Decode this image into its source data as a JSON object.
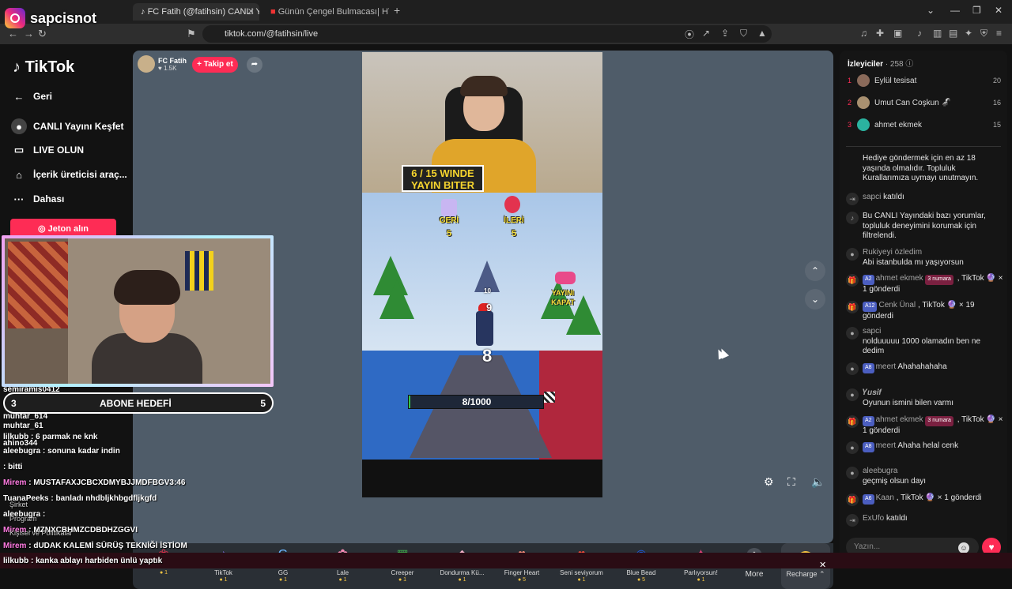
{
  "overlay": {
    "brand": "sapcisnot"
  },
  "browser": {
    "tabs": [
      {
        "label": "FC Fatih (@fatihsin) CANLI Ya",
        "active": true
      },
      {
        "label": "Günün Çengel Bulmacası| HT Bulmac",
        "active": false
      }
    ],
    "url": "tiktok.com/@fatihsin/live"
  },
  "sidebar": {
    "logo": "TikTok",
    "items": [
      {
        "label": "Geri",
        "icon": "arrow-left-icon"
      },
      {
        "label": "CANLI Yayını Keşfet",
        "icon": "live-explore-icon"
      },
      {
        "label": "LIVE OLUN",
        "icon": "video-camera-icon"
      },
      {
        "label": "İçerik üreticisi araç...",
        "icon": "creator-tools-icon"
      },
      {
        "label": "Dahası",
        "icon": "more-dots-icon"
      }
    ],
    "coins_button": "Jeton alın"
  },
  "stage": {
    "host_name": "FC Fatih",
    "host_likes": "1.5K",
    "follow_label": "+ Takip et",
    "video_banner_line1": "6 / 15 WINDE",
    "video_banner_line2": "YAYIN BITER",
    "game": {
      "left_label": "GERİ",
      "left_value": "5",
      "right_label": "İLERİ",
      "right_value": "5",
      "car_label_1": "YAYINI",
      "car_label_2": "KAPAT",
      "tower_number": "10",
      "center_number": "9",
      "player_number": "8",
      "progress_text": "8/1000",
      "progress_fraction": 0.008
    }
  },
  "gifts": [
    {
      "name": "",
      "price": "1",
      "icon": "rose-icon",
      "color": "#e3334f",
      "glyph": "❀"
    },
    {
      "name": "TikTok",
      "price": "1",
      "icon": "tiktok-gift-icon",
      "color": "#7f6bd9",
      "glyph": "♪"
    },
    {
      "name": "GG",
      "price": "1",
      "icon": "gg-icon",
      "color": "#6bb6ff",
      "glyph": "G"
    },
    {
      "name": "Lale",
      "price": "1",
      "icon": "tulip-icon",
      "color": "#f58bb4",
      "glyph": "✿"
    },
    {
      "name": "Creeper",
      "price": "1",
      "icon": "creeper-icon",
      "color": "#3ea34b",
      "glyph": "▦"
    },
    {
      "name": "Dondurma Kü...",
      "price": "1",
      "icon": "ice-cream-icon",
      "color": "#f4b2c9",
      "glyph": "◆"
    },
    {
      "name": "Finger Heart",
      "price": "5",
      "icon": "finger-heart-icon",
      "color": "#f28a7a",
      "glyph": "♥"
    },
    {
      "name": "Seni seviyorum",
      "price": "1",
      "icon": "love-you-icon",
      "color": "#e94b3c",
      "glyph": "♥"
    },
    {
      "name": "Blue Bead",
      "price": "5",
      "icon": "blue-bead-icon",
      "color": "#1f56d1",
      "glyph": "◉"
    },
    {
      "name": "Parlıyorsun!",
      "price": "1",
      "icon": "shining-icon",
      "color": "#e8457d",
      "glyph": "✦"
    }
  ],
  "gift_more": "More",
  "recharge": "Recharge",
  "viewers": {
    "title": "İzleyiciler",
    "count": "258",
    "top": [
      {
        "rank": "1",
        "name": "Eylül tesisat",
        "score": "20",
        "color": "#8a6a5a"
      },
      {
        "rank": "2",
        "name": "Umut Can Coşkun 🦨",
        "score": "16",
        "color": "#a89070"
      },
      {
        "rank": "3",
        "name": "ahmet ekmek",
        "score": "15",
        "color": "#2bb3a0"
      }
    ]
  },
  "chat": [
    {
      "user": "",
      "text": "Hediye göndermek için en az 18 yaşında olmalıdır. Topluluk Kurallarımıza uymayı unutmayın."
    },
    {
      "user": "sapci",
      "text": "katıldı"
    },
    {
      "user": "",
      "text": "Bu CANLI Yayındaki bazı yorumlar, topluluk deneyimini korumak için filtrelendi."
    },
    {
      "user": "Rukiyeyi özledim",
      "text": "Abi istanbulda mı yaşıyorsun"
    },
    {
      "badge": "A2",
      "user": "ahmet ekmek",
      "rank_badge": "3 numara",
      "text": ", TikTok 🔮 × 1 gönderdi"
    },
    {
      "badge": "A12",
      "user": "Cenk Ünal",
      "text": ", TikTok 🔮 × 19 gönderdi"
    },
    {
      "user": "sapci",
      "text": "nolduuuuu 1000 olamadın ben ne dedim"
    },
    {
      "badge": "A8",
      "user": "meert",
      "text": "Ahahahahaha"
    },
    {
      "user": "𝒀𝒖𝒔𝒊𝒇",
      "text": "Oyunun ismini bilen varmı"
    },
    {
      "badge": "A2",
      "user": "ahmet ekmek",
      "rank_badge": "3 numara",
      "text": ", TikTok 🔮 × 1 gönderdi"
    },
    {
      "badge": "A8",
      "user": "meert",
      "text": "Ahaha helal cenk"
    },
    {
      "user": "aleebugra",
      "text": "geçmiş olsun dayı"
    },
    {
      "badge": "A6",
      "user": "Kaan",
      "text": ", TikTok 🔮 × 1 gönderdi"
    },
    {
      "user": "ExUfo",
      "text": "katıldı"
    }
  ],
  "chat_input_placeholder": "Yazın...",
  "webcam": {
    "goal_left": "3",
    "goal_label": "ABONE HEDEFİ",
    "goal_right": "5"
  },
  "overlay_chat": [
    {
      "user": "",
      "text": "semiramis0412"
    },
    {
      "user": "",
      "text": "muhtar_614"
    },
    {
      "user": "",
      "text": "muhtar_61"
    },
    {
      "user": "lilkubb",
      "text": ": 6 parmak ne knk"
    },
    {
      "user": "",
      "text": "ahino344"
    },
    {
      "user": "aleebugra",
      "text": ": sonuna kadar indin"
    },
    {
      "user": "",
      "text": ": bitti"
    },
    {
      "user": "Mirem",
      "text": ": MUSTAFAXJCBCXDMYBJJMDFBGV3:46"
    },
    {
      "user": "TuanaPeeks",
      "text": ": banladı nhdbljkhbgdfljkgfd"
    },
    {
      "user": "aleebugra",
      "text": ":"
    },
    {
      "user": "Mirem",
      "text": ": MZNXCBHMZCDBDHZGGVI"
    },
    {
      "user": "Mirem",
      "text": ": dUDAK KALEMİ SÜRÜŞ TEKNİĞİ İSTİOM"
    },
    {
      "user": "lilkubb",
      "text": ": kanka ablayı harbiden ünlü yaptık"
    }
  ],
  "overlay_side": [
    "Şirket",
    "Program",
    "Kişisel ve Politikalar"
  ]
}
